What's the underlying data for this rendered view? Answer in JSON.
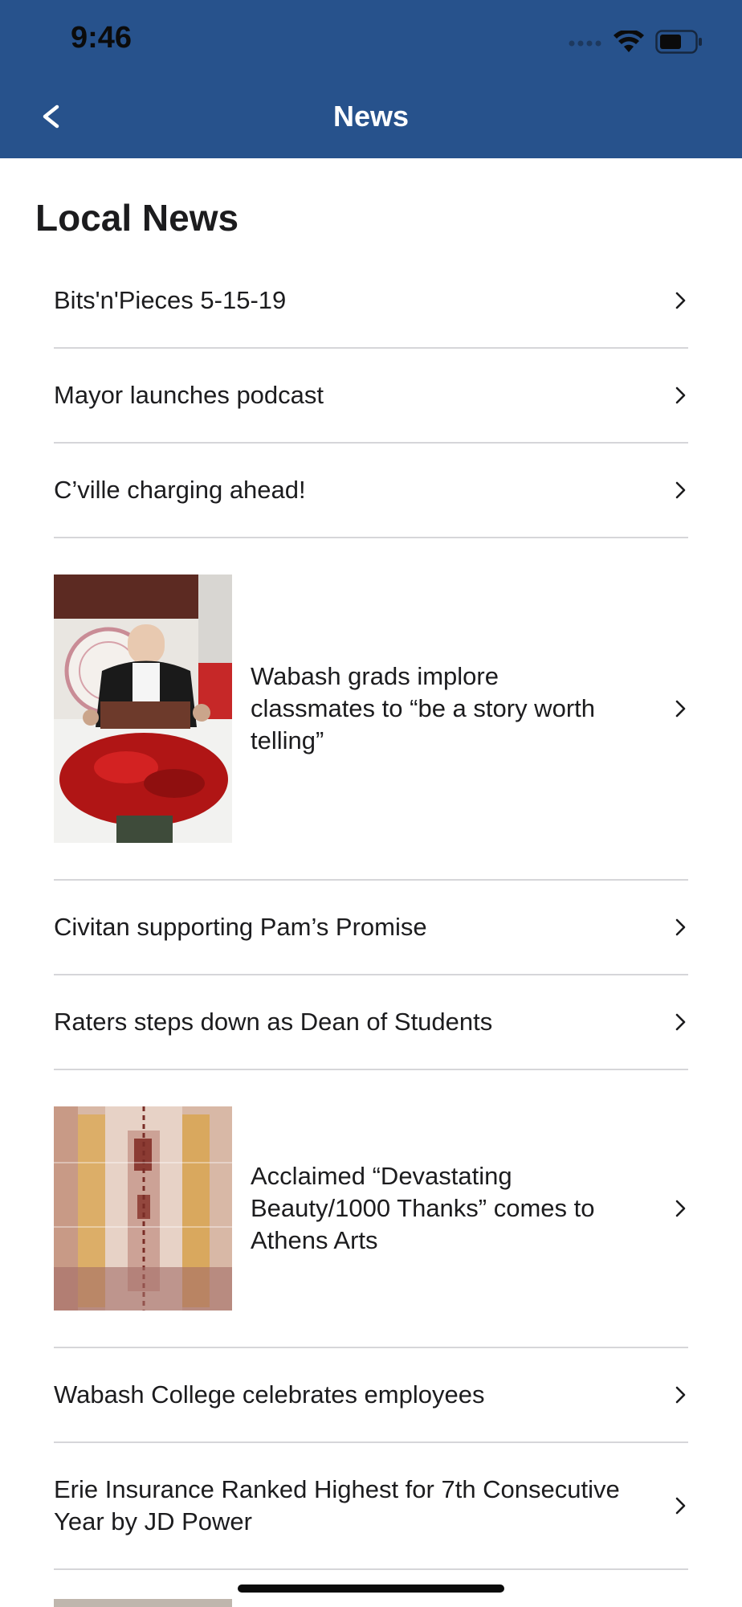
{
  "status_bar": {
    "time": "9:46"
  },
  "nav": {
    "back_label": "<",
    "title": "News"
  },
  "section": {
    "title": "Local News"
  },
  "articles": [
    {
      "title": "Bits'n'Pieces 5-15-19"
    },
    {
      "title": "Mayor launches podcast"
    },
    {
      "title": "C’ville charging ahead!"
    },
    {
      "title": "Wabash grads implore classmates to “be a story worth telling”",
      "image": "graduation-speaker-photo"
    },
    {
      "title": "Civitan supporting Pam’s Promise"
    },
    {
      "title": "Raters steps down as Dean of Students"
    },
    {
      "title": "Acclaimed “Devastating Beauty/1000 Thanks” comes to Athens Arts",
      "image": "artwork-photo"
    },
    {
      "title": "Wabash College celebrates employees"
    },
    {
      "title": "Erie Insurance Ranked Highest for 7th Consecutive Year by JD Power"
    }
  ],
  "colors": {
    "header": "#27528c",
    "divider": "#d6d6d9",
    "text": "#1c1c1e"
  },
  "icons": [
    "signal-icon",
    "wifi-icon",
    "battery-icon",
    "back-icon",
    "chevron-right-icon"
  ]
}
